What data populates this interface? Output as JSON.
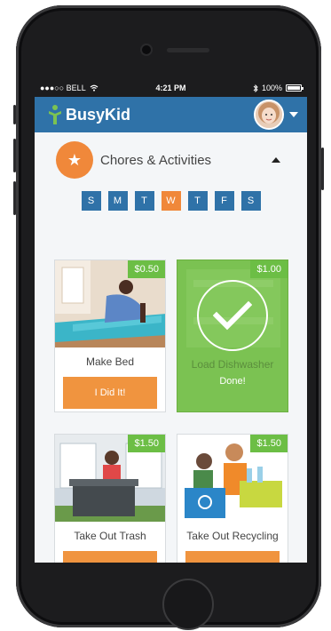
{
  "status_bar": {
    "carrier": "●●●○○ BELL",
    "time": "4:21 PM",
    "battery": "100%"
  },
  "app": {
    "brand": "BusyKid",
    "profile_menu": "chevron-down-icon"
  },
  "section": {
    "title": "Chores & Activities",
    "icon": "star-icon"
  },
  "days": [
    {
      "label": "S",
      "active": false
    },
    {
      "label": "M",
      "active": false
    },
    {
      "label": "T",
      "active": false
    },
    {
      "label": "W",
      "active": true
    },
    {
      "label": "T",
      "active": false
    },
    {
      "label": "F",
      "active": false
    },
    {
      "label": "S",
      "active": false
    }
  ],
  "chores": [
    {
      "title": "Make Bed",
      "price": "$0.50",
      "button": "I Did It!",
      "status": ""
    },
    {
      "title": "Load Dishwasher",
      "price": "$1.00",
      "button": "",
      "status": "Done!"
    },
    {
      "title": "Take Out Trash",
      "price": "$1.50",
      "button": "",
      "status": ""
    },
    {
      "title": "Take Out Recycling",
      "price": "$1.50",
      "button": "",
      "status": ""
    }
  ],
  "colors": {
    "appbar": "#2f72a8",
    "accent_orange": "#f0883a",
    "done_green": "#7bc252",
    "price_green": "#6cbe45"
  }
}
